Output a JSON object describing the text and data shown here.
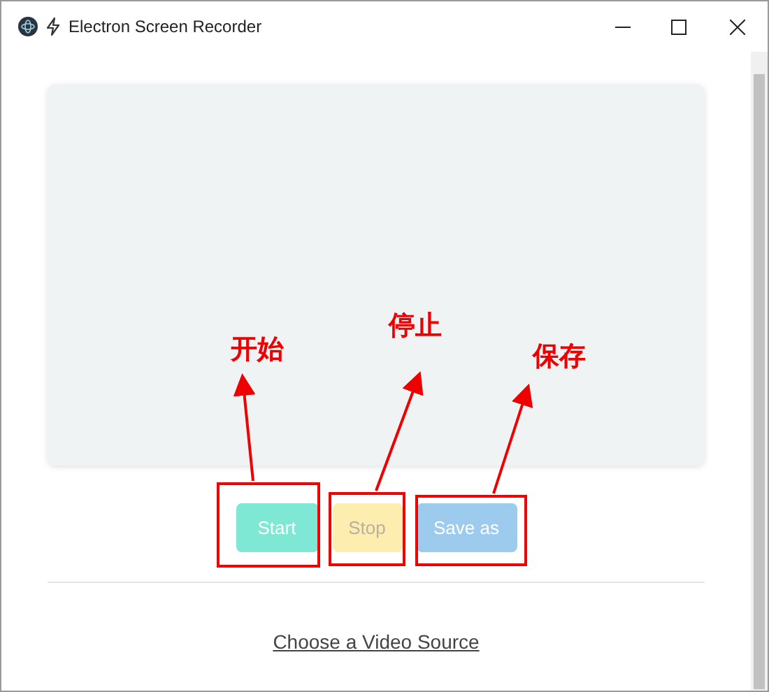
{
  "window": {
    "title": "Electron Screen Recorder"
  },
  "buttons": [
    {
      "label": "Start",
      "kind": "start",
      "disabled": false
    },
    {
      "label": "Stop",
      "kind": "stop",
      "disabled": true
    },
    {
      "label": "Save as",
      "kind": "save",
      "disabled": false
    }
  ],
  "link": {
    "label": "Choose a Video Source"
  },
  "annotations": [
    {
      "label": "开始"
    },
    {
      "label": "停止"
    },
    {
      "label": "保存"
    }
  ]
}
